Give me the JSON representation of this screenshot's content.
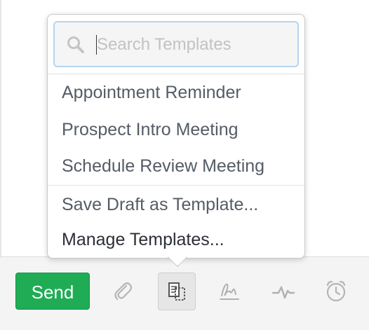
{
  "popover": {
    "search": {
      "placeholder": "Search Templates",
      "value": ""
    },
    "templates": [
      {
        "label": "Appointment Reminder"
      },
      {
        "label": "Prospect Intro Meeting"
      },
      {
        "label": "Schedule Review Meeting"
      }
    ],
    "actions": {
      "save_draft": "Save Draft as Template...",
      "manage": "Manage Templates..."
    }
  },
  "toolbar": {
    "send_label": "Send",
    "tools": [
      {
        "icon": "paperclip-icon",
        "active": false
      },
      {
        "icon": "templates-icon",
        "active": true
      },
      {
        "icon": "signature-icon",
        "active": false
      },
      {
        "icon": "activity-pulse-icon",
        "active": false
      },
      {
        "icon": "alarm-clock-icon",
        "active": false
      }
    ]
  },
  "colors": {
    "send_green": "#1fac55",
    "search_focus_border": "#b7d4ef"
  }
}
